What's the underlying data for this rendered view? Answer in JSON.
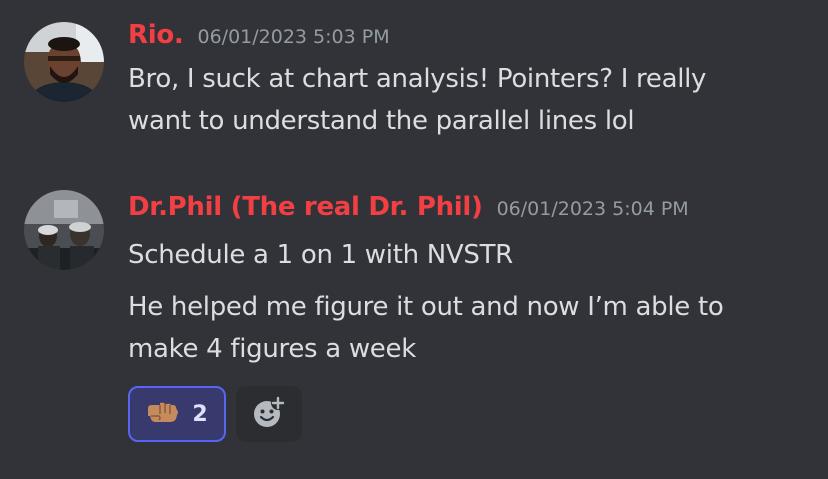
{
  "colors": {
    "background": "#313338",
    "username": "#f23f43",
    "timestamp": "#949ba4",
    "message_text": "#dbdee1",
    "reaction_bg": "#383a6d",
    "reaction_border": "#5865f2"
  },
  "messages": [
    {
      "author": "Rio.",
      "timestamp": "06/01/2023 5:03 PM",
      "avatar_icon": "user-avatar-photo",
      "paragraphs": [
        [
          "Bro, I suck at chart analysis! Pointers? I really",
          "want to understand the parallel lines lol"
        ]
      ]
    },
    {
      "author": "Dr.Phil (The real Dr. Phil)",
      "timestamp": "06/01/2023 5:04 PM",
      "avatar_icon": "user-avatar-photo",
      "paragraphs": [
        [
          "Schedule a 1 on 1 with NVSTR"
        ],
        [
          "He helped me figure it out and now I’m able to",
          "make 4 figures a week"
        ]
      ],
      "reactions": [
        {
          "emoji": "fist-bump-emoji",
          "count": "2"
        }
      ],
      "add_reaction_icon": "add-reaction-icon"
    }
  ]
}
